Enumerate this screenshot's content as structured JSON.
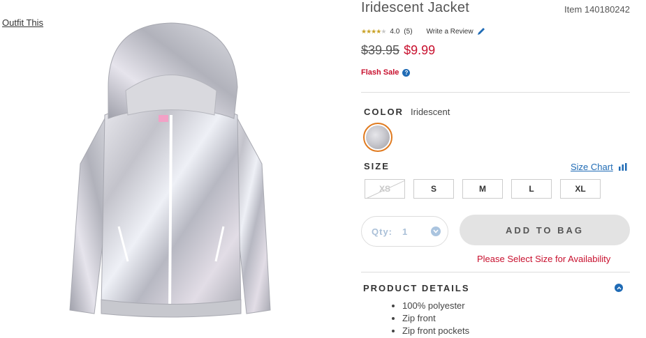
{
  "outfit_link": "Outfit This",
  "product": {
    "title": "Iridescent Jacket",
    "item_number": "Item 140180242",
    "rating": {
      "stars_filled": 4,
      "stars_total": 5,
      "value": "4.0",
      "count": "(5)"
    },
    "write_review": "Write a Review",
    "price_original": "$39.95",
    "price_sale": "$9.99",
    "flash_sale": "Flash Sale",
    "flash_help": "?"
  },
  "color": {
    "label": "COLOR",
    "selected": "Iridescent",
    "swatch_accent": "#e07a1f"
  },
  "size": {
    "label": "SIZE",
    "chart_link": "Size Chart",
    "options": [
      {
        "label": "XS",
        "available": false
      },
      {
        "label": "S",
        "available": true
      },
      {
        "label": "M",
        "available": true
      },
      {
        "label": "L",
        "available": true
      },
      {
        "label": "XL",
        "available": true
      }
    ]
  },
  "quantity": {
    "label": "Qty:",
    "value": "1"
  },
  "add_to_bag": "ADD TO BAG",
  "availability_message": "Please Select Size for Availability",
  "details": {
    "label": "PRODUCT DETAILS",
    "items": [
      "100% polyester",
      "Zip front",
      "Zip front pockets"
    ]
  },
  "colors": {
    "accent_blue": "#1f6bb5",
    "sale_red": "#c8102e"
  }
}
